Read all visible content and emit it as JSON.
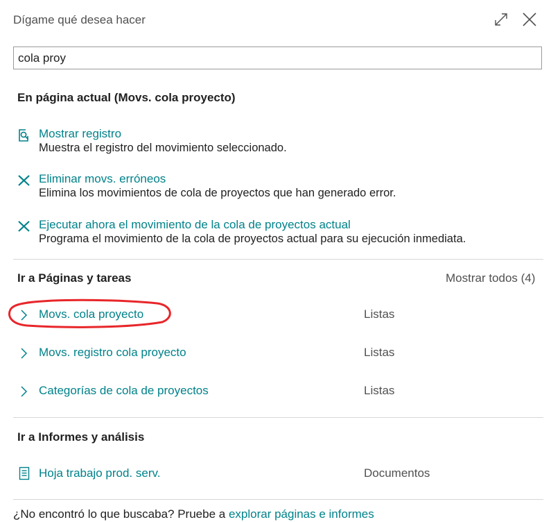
{
  "dialog": {
    "title": "Dígame qué desea hacer",
    "search_value": "cola proy",
    "expand_icon": "expand-icon",
    "close_icon": "close-icon"
  },
  "current_page": {
    "title": "En página actual (Movs. cola proyecto)",
    "actions": [
      {
        "icon": "show-record-icon",
        "title": "Mostrar registro",
        "description": "Muestra el registro del movimiento seleccionado."
      },
      {
        "icon": "action-x-icon",
        "title": "Eliminar movs. erróneos",
        "description": "Elimina los movimientos de cola de proyectos que han generado error."
      },
      {
        "icon": "action-x-icon",
        "title": "Ejecutar ahora el movimiento de la cola de proyectos actual",
        "description": "Programa el movimiento de la cola de proyectos actual para su ejecución inmediata."
      }
    ]
  },
  "pages_tasks": {
    "title": "Ir a Páginas y tareas",
    "show_all": "Mostrar todos (4)",
    "items": [
      {
        "title": "Movs. cola proyecto",
        "category": "Listas",
        "highlighted": true
      },
      {
        "title": "Movs. registro cola proyecto",
        "category": "Listas"
      },
      {
        "title": "Categorías de cola de proyectos",
        "category": "Listas"
      }
    ]
  },
  "reports": {
    "title": "Ir a Informes y análisis",
    "items": [
      {
        "icon": "document-icon",
        "title": "Hoja trabajo prod. serv.",
        "category": "Documentos"
      }
    ]
  },
  "footer": {
    "text": "¿No encontró lo que buscaba? Pruebe a ",
    "link": "explorar páginas e informes"
  },
  "colors": {
    "accent": "#00828a",
    "highlight": "#e8262a"
  }
}
